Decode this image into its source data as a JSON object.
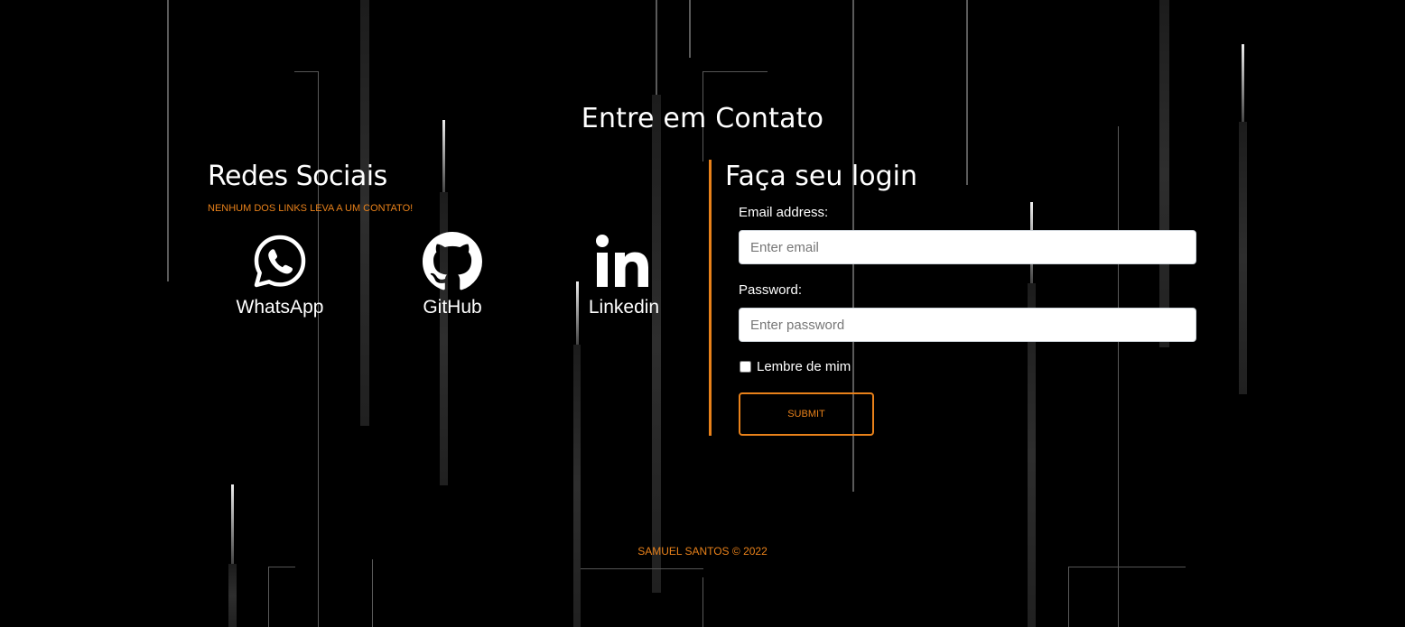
{
  "header": {
    "title": "Entre em Contato"
  },
  "social": {
    "heading": "Redes Sociais",
    "note": "NENHUM DOS LINKS LEVA A UM CONTATO!",
    "items": [
      {
        "label": "WhatsApp",
        "icon": "whatsapp-icon"
      },
      {
        "label": "GitHub",
        "icon": "github-icon"
      },
      {
        "label": "Linkedin",
        "icon": "linkedin-icon"
      }
    ]
  },
  "login": {
    "heading": "Faça seu login",
    "email_label": "Email address:",
    "email_placeholder": "Enter email",
    "email_value": "",
    "password_label": "Password:",
    "password_placeholder": "Enter password",
    "password_value": "",
    "remember_label": "Lembre de mim",
    "submit_label": "SUBMIT"
  },
  "footer": {
    "text": "SAMUEL SANTOS © 2022"
  },
  "colors": {
    "background": "#000000",
    "accent": "#e8811a",
    "text": "#ffffff"
  }
}
